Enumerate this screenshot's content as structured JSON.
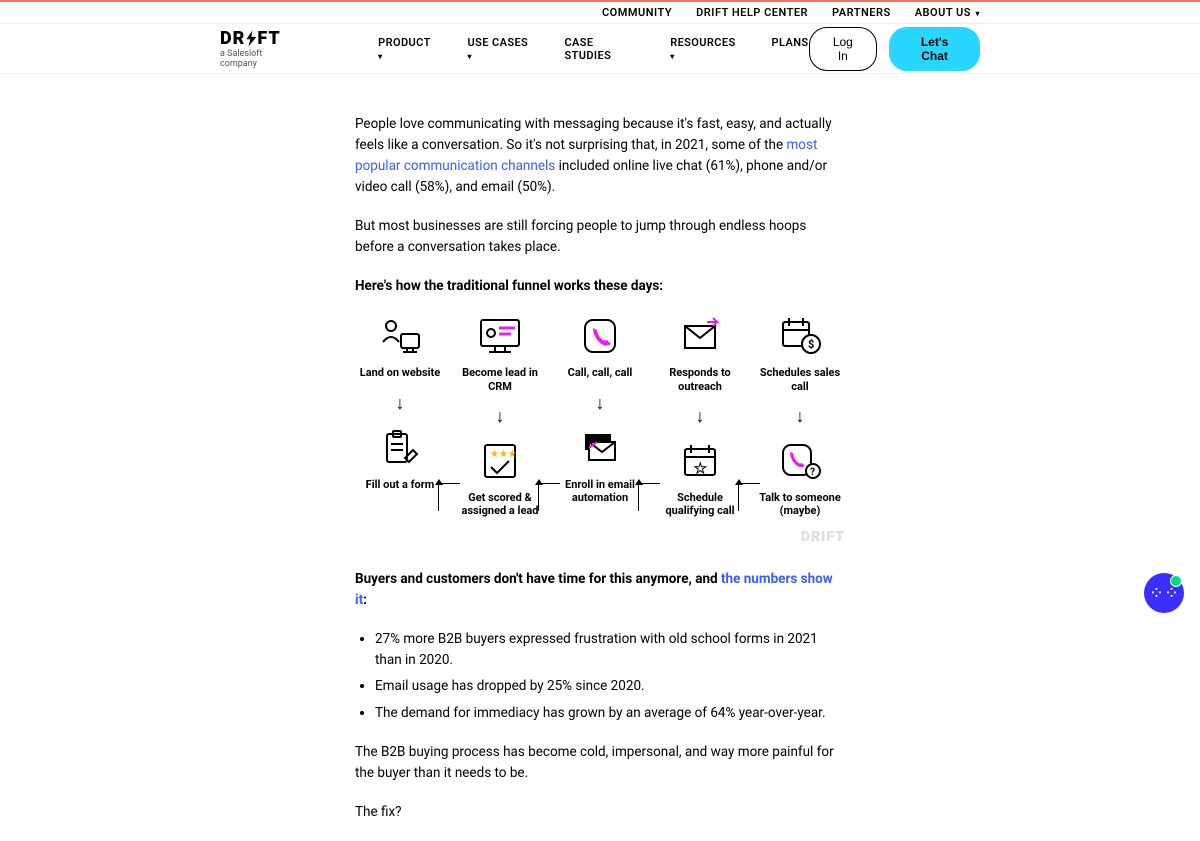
{
  "topnav": {
    "items": [
      "COMMUNITY",
      "DRIFT HELP CENTER",
      "PARTNERS",
      "ABOUT US"
    ]
  },
  "logo": {
    "text_left": "DR",
    "text_right": "FT",
    "tagline": "a Salesloft company"
  },
  "mainnav": {
    "items": [
      "PRODUCT",
      "USE CASES",
      "CASE STUDIES",
      "RESOURCES",
      "PLANS"
    ]
  },
  "actions": {
    "login": "Log In",
    "chat": "Let's Chat"
  },
  "para1_a": "People love communicating with messaging because it's fast, easy, and actually feels like a conversation. So it's not surprising that, in 2021, some of the ",
  "para1_link": "most popular communication channels",
  "para1_b": " included online live chat (61%), phone and/or video call (58%), and email (50%).",
  "para2": "But most businesses are still forcing people to jump through endless hoops before a conversation takes place.",
  "para3": "Here's how the traditional funnel works these days:",
  "funnel": {
    "cols": [
      {
        "top": "Land on website",
        "bottom": "Fill out a form"
      },
      {
        "top": "Become lead in CRM",
        "bottom": "Get scored & assigned a lead"
      },
      {
        "top": "Call, call, call",
        "bottom": "Enroll in email automation"
      },
      {
        "top": "Responds to outreach",
        "bottom": "Schedule qualifying call"
      },
      {
        "top": "Schedules sales call",
        "bottom": "Talk to someone (maybe)"
      }
    ]
  },
  "watermark": "DRIFT",
  "para4_a": "Buyers and customers don't have time for this anymore, and ",
  "para4_link": "the numbers show it",
  "para4_b": ":",
  "bullets": [
    "27% more B2B buyers expressed frustration with old school forms in 2021 than in 2020.",
    "Email usage has dropped by 25% since 2020.",
    "The demand for immediacy has grown by an average of 64% year-over-year."
  ],
  "para5": "The B2B buying process has become cold, impersonal, and way more painful for the buyer than it needs to be.",
  "para6": "The fix?"
}
